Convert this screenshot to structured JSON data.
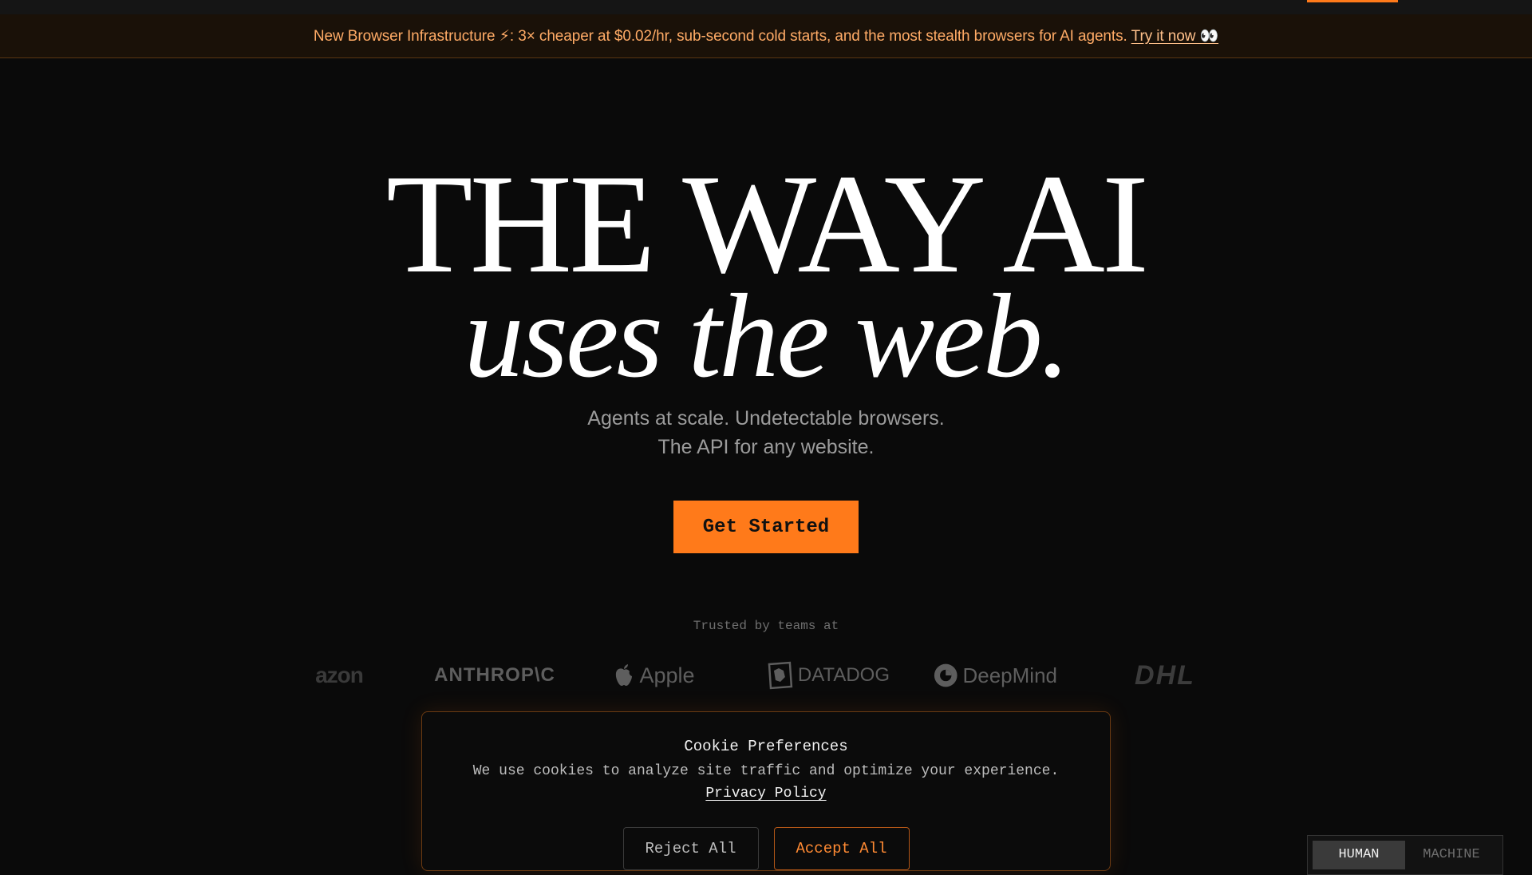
{
  "announcement": {
    "text": "New Browser Infrastructure ⚡: 3× cheaper at $0.02/hr, sub-second cold starts, and the most stealth browsers for AI agents.",
    "link": "Try it now 👀"
  },
  "hero": {
    "line1": "THE WAY AI",
    "line2": "uses the web."
  },
  "subtitle": {
    "line1": "Agents at scale. Undetectable browsers.",
    "line2": "The API for any website."
  },
  "cta": {
    "label": "Get Started"
  },
  "trusted": {
    "label": "Trusted by teams at",
    "logos": [
      {
        "name": "amazon",
        "text": "azon"
      },
      {
        "name": "anthropic",
        "text": "ANTHROP\\C"
      },
      {
        "name": "apple",
        "text": "Apple",
        "icon": "apple-icon"
      },
      {
        "name": "datadog",
        "text": "DATADOG",
        "icon": "datadog-dog-icon"
      },
      {
        "name": "deepmind",
        "text": "DeepMind",
        "icon": "deepmind-icon"
      },
      {
        "name": "dhl",
        "text": "DHL"
      }
    ]
  },
  "cookie": {
    "title": "Cookie Preferences",
    "text": "We use cookies to analyze site traffic and optimize your experience.",
    "link": "Privacy Policy",
    "reject_label": "Reject All",
    "accept_label": "Accept All"
  },
  "mode_toggle": {
    "options": [
      "HUMAN",
      "MACHINE"
    ],
    "selected": "HUMAN"
  },
  "colors": {
    "accent": "#ff7a1a",
    "background": "#0a0a0a"
  }
}
